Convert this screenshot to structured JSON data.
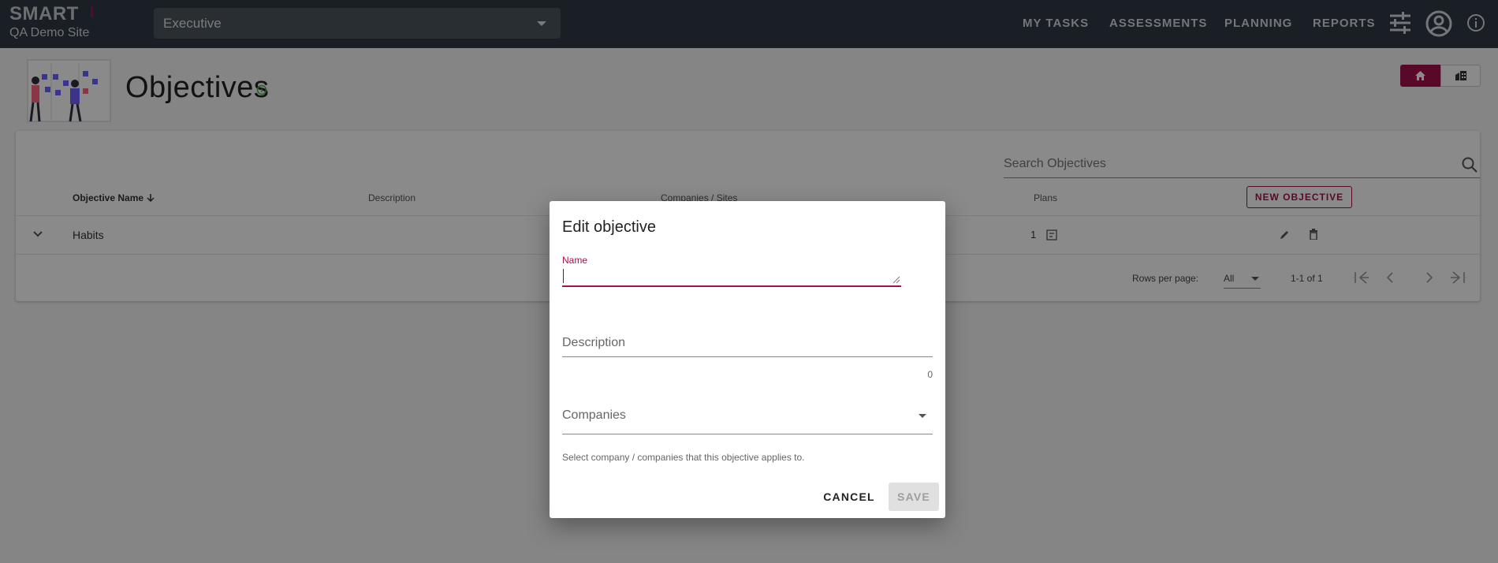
{
  "app": {
    "brand": "SMART",
    "site_name": "QA Demo Site",
    "context_select": "Executive",
    "accent": "#a3114f",
    "nav": [
      "MY TASKS",
      "ASSESSMENTS",
      "PLANNING",
      "REPORTS"
    ]
  },
  "page": {
    "title": "Objectives",
    "search_placeholder": "Search Objectives",
    "new_button": "NEW OBJECTIVE",
    "columns": [
      "Objective Name",
      "Description",
      "Companies / Sites",
      "Plans"
    ],
    "rows": [
      {
        "name": "Habits",
        "plans": "1"
      }
    ],
    "footer": {
      "rows_per_page_label": "Rows per page:",
      "rows_per_page_value": "All",
      "range": "1-1 of 1"
    }
  },
  "dialog": {
    "title": "Edit objective",
    "name_label": "Name",
    "description_label": "Description",
    "description_counter": "0",
    "companies_label": "Companies",
    "companies_hint": "Select company / companies that this objective applies to.",
    "cancel": "CANCEL",
    "save": "SAVE"
  }
}
